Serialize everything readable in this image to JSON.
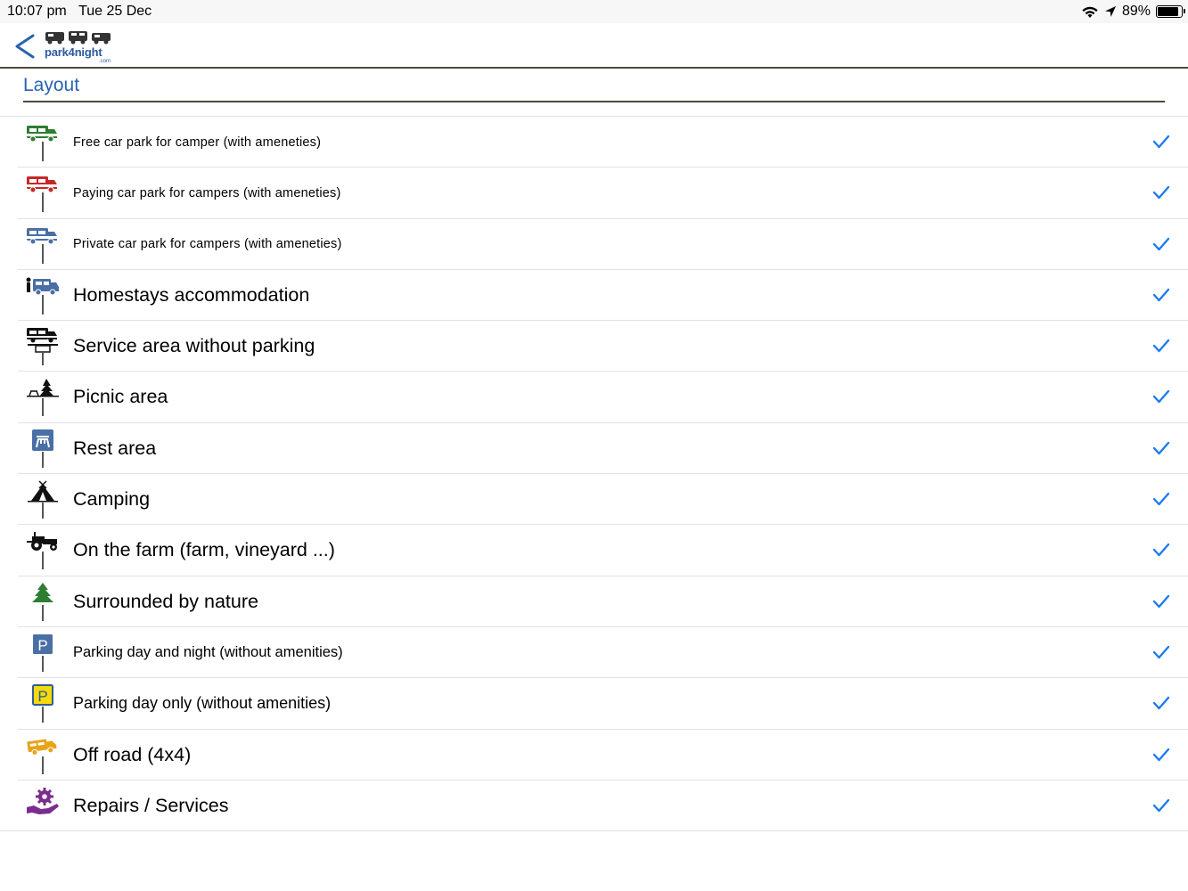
{
  "status_bar": {
    "time": "10:07 pm",
    "date": "Tue 25 Dec",
    "battery": "89%",
    "battery_level": 0.89
  },
  "nav": {
    "back_icon": "chevron-left-icon",
    "logo_text": "park4night",
    "logo_suffix": ".com"
  },
  "section": {
    "title": "Layout"
  },
  "colors": {
    "accent": "#1e7bf0",
    "title_blue": "#2a62b0",
    "divider": "#4b4b3a"
  },
  "items": [
    {
      "label": "Free car park for camper (with ameneties)",
      "icon": "green-camper-icon",
      "checked": true,
      "size": "small"
    },
    {
      "label": "Paying car park for campers (with ameneties)",
      "icon": "red-camper-icon",
      "checked": true,
      "size": "small"
    },
    {
      "label": "Private car park for campers (with ameneties)",
      "icon": "blue-camper-icon",
      "checked": true,
      "size": "small"
    },
    {
      "label": "Homestays accommodation",
      "icon": "homestay-icon",
      "checked": true,
      "size": "big"
    },
    {
      "label": "Service area without parking",
      "icon": "service-area-icon",
      "checked": true,
      "size": "big"
    },
    {
      "label": "Picnic area",
      "icon": "picnic-icon",
      "checked": true,
      "size": "big"
    },
    {
      "label": "Rest area",
      "icon": "rest-area-icon",
      "checked": true,
      "size": "big"
    },
    {
      "label": "Camping",
      "icon": "tent-icon",
      "checked": true,
      "size": "big"
    },
    {
      "label": "On the farm (farm, vineyard ...)",
      "icon": "tractor-icon",
      "checked": true,
      "size": "big"
    },
    {
      "label": "Surrounded by nature",
      "icon": "tree-icon",
      "checked": true,
      "size": "big"
    },
    {
      "label": "Parking day and night (without amenities)",
      "icon": "parking-blue-icon",
      "checked": true,
      "size": "mid"
    },
    {
      "label": "Parking day only (without amenities)",
      "icon": "parking-yellow-icon",
      "checked": true,
      "size": "mid"
    },
    {
      "label": "Off road (4x4)",
      "icon": "offroad-icon",
      "checked": true,
      "size": "big"
    },
    {
      "label": "Repairs / Services",
      "icon": "repairs-icon",
      "checked": true,
      "size": "big"
    }
  ]
}
